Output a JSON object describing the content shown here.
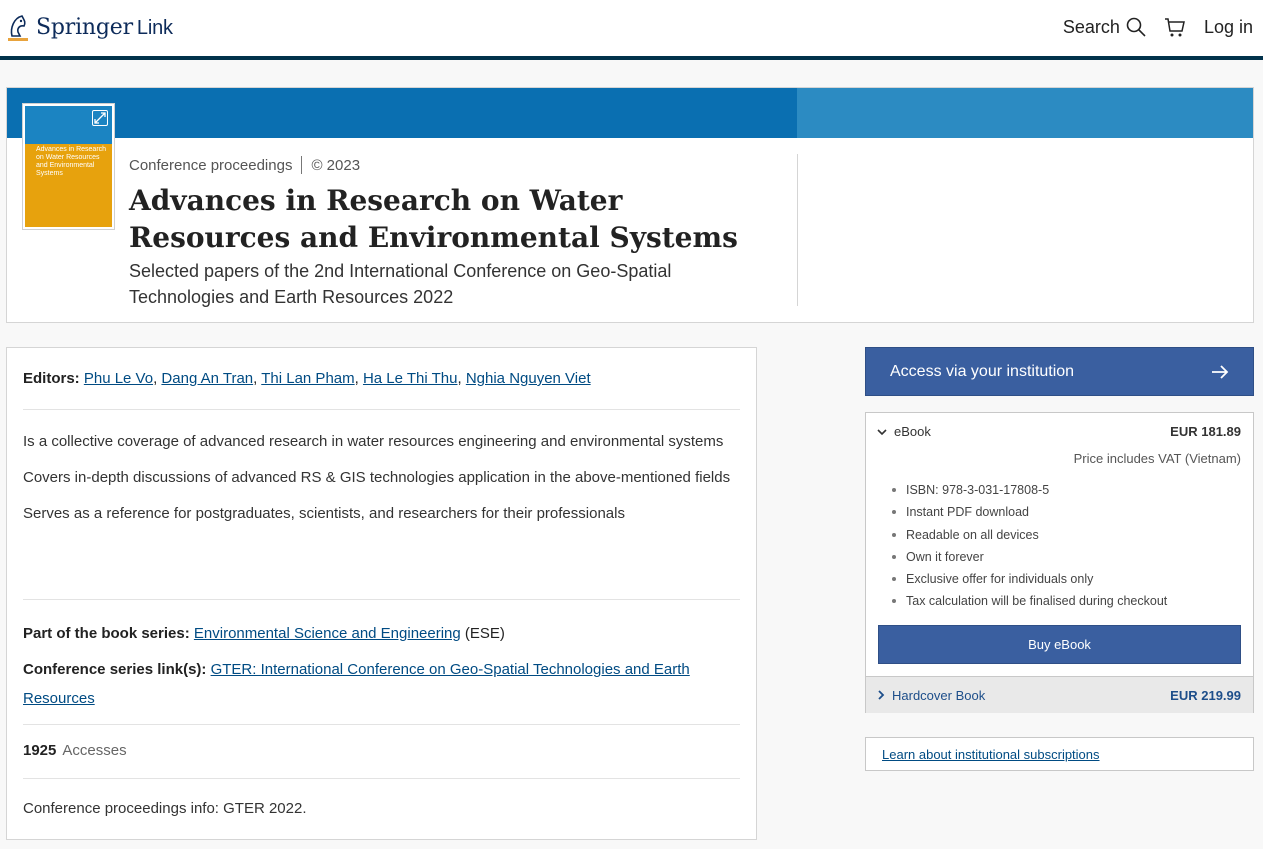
{
  "header": {
    "logo_brand": "Springer",
    "logo_suffix": "Link",
    "search_label": "Search",
    "login_label": "Log in"
  },
  "hero": {
    "type_label": "Conference proceedings",
    "year_label": "© 2023",
    "title": "Advances in Research on Water Resources and Environmental Systems",
    "subtitle": "Selected papers of the 2nd International Conference on Geo-Spatial Technologies and Earth Resources 2022",
    "cover_title": "Advances in Research on Water Resources and Environmental Systems",
    "colors": {
      "band": "#0a6fb1",
      "band_right": "#2c8bc2",
      "cover": "#e7a20d"
    }
  },
  "content": {
    "editors_label": "Editors:",
    "editors": [
      "Phu Le Vo",
      "Dang An Tran",
      "Thi Lan Pham",
      "Ha Le Thi Thu",
      "Nghia Nguyen Viet"
    ],
    "highlights": [
      "Is a collective coverage of advanced research in water resources engineering and environmental systems",
      "Covers in-depth discussions of advanced RS & GIS technologies application in the above-mentioned fields",
      "Serves as a reference for postgraduates, scientists, and researchers for their professionals"
    ],
    "series_label": "Part of the book series:",
    "series_link": "Environmental Science and Engineering",
    "series_abbr": "(ESE)",
    "conf_label": "Conference series link(s):",
    "conf_link": "GTER: International Conference on Geo-Spatial Technologies and Earth Resources",
    "accesses_count": "1925",
    "accesses_label": "Accesses",
    "info": "Conference proceedings info: GTER 2022."
  },
  "sidebar": {
    "access_button": "Access via your institution",
    "ebook_label": "eBook",
    "ebook_price": "EUR 181.89",
    "vat_note": "Price includes VAT (Vietnam)",
    "features": [
      "ISBN: 978-3-031-17808-5",
      "Instant PDF download",
      "Readable on all devices",
      "Own it forever",
      "Exclusive offer for individuals only",
      "Tax calculation will be finalised during checkout"
    ],
    "buy_button": "Buy eBook",
    "hardcover_label": "Hardcover Book",
    "hardcover_price": "EUR 219.99",
    "learn_link": "Learn about institutional subscriptions",
    "accent_color": "#3a5fa0"
  }
}
